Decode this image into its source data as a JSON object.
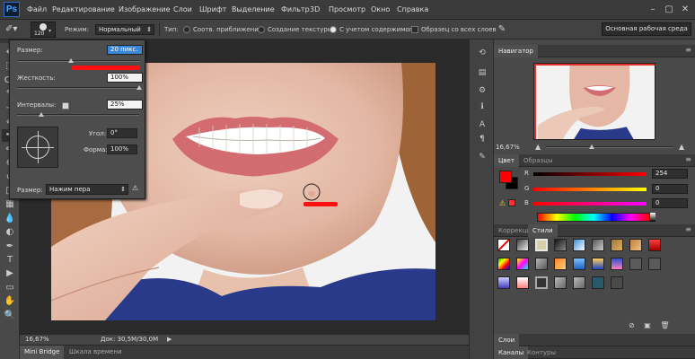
{
  "menubar": {
    "logo": "Ps",
    "items": [
      "Файл",
      "Редактирование",
      "Изображение",
      "Слои",
      "Шрифт",
      "Выделение",
      "Фильтр",
      "3D",
      "Просмотр",
      "Окно",
      "Справка"
    ],
    "win_minimize": "–",
    "win_restore": "▢",
    "win_close": "✕"
  },
  "options": {
    "brush_size": "120",
    "mode_label": "Режим:",
    "mode_value": "Нормальный",
    "type_label": "Тип:",
    "radio_1": "Соотв. приближения",
    "radio_2": "Создание текстуры",
    "radio_3": "С учетом содержимого",
    "checkbox": "Образец со всех слоев",
    "workspace": "Основная рабочая среда"
  },
  "brush_popup": {
    "size_label": "Размер:",
    "size_value": "20 пикс.",
    "hardness_label": "Жесткость:",
    "hardness_value": "100%",
    "spacing_label": "Интервалы:",
    "spacing_value": "25%",
    "angle_label": "Угол:",
    "angle_value": "0°",
    "roundness_label": "Форма:",
    "roundness_value": "100%",
    "size_control_label": "Размер:",
    "size_control_value": "Нажим пера",
    "size_level": 0.44,
    "hardness_level": 1.0,
    "spacing_level": 0.2
  },
  "status": {
    "zoom": "16,67%",
    "doc_info": "Док: 30,5M/30,0M"
  },
  "bottom_tabs": [
    "Mini Bridge",
    "Шкала времени"
  ],
  "navigator": {
    "title": "Навигатор",
    "zoom": "16,67%"
  },
  "color_panel": {
    "tabs": [
      "Цвет",
      "Образцы"
    ],
    "channels": [
      {
        "label": "R",
        "value": "254"
      },
      {
        "label": "G",
        "value": "0"
      },
      {
        "label": "B",
        "value": "0"
      }
    ],
    "foreground": "#fe0000",
    "background": "#000000"
  },
  "styles_panel": {
    "tabs": [
      "Коррекция",
      "Стили"
    ]
  },
  "layers_panel": {
    "title": "Слои"
  },
  "channels_panel": {
    "tabs": [
      "Каналы",
      "Контуры"
    ]
  },
  "toolbar": {
    "tools": [
      "move-tool-icon",
      "marquee-tool-icon",
      "lasso-tool-icon",
      "quick-selection-tool-icon",
      "crop-tool-icon",
      "eyedropper-tool-icon",
      "healing-brush-tool-icon",
      "brush-tool-icon",
      "clone-stamp-tool-icon",
      "history-brush-tool-icon",
      "eraser-tool-icon",
      "gradient-tool-icon",
      "blur-tool-icon",
      "dodge-tool-icon",
      "pen-tool-icon",
      "type-tool-icon",
      "path-selection-tool-icon",
      "rectangle-tool-icon",
      "hand-tool-icon",
      "zoom-tool-icon"
    ],
    "glyphs": [
      "✥",
      "⬚",
      "ↀ",
      "✎",
      "⊹",
      "✐",
      "✚",
      "✏",
      "⊕",
      "↺",
      "◫",
      "▦",
      "💧",
      "◐",
      "✒",
      "T",
      "▶",
      "▭",
      "✋",
      "🔍"
    ]
  },
  "accent": "#ff1010"
}
